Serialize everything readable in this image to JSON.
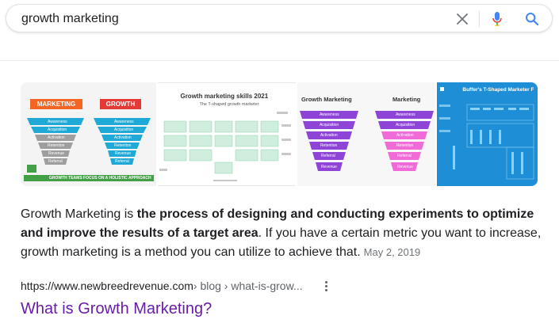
{
  "search": {
    "query": "growth marketing"
  },
  "icons": {
    "clear": "close-icon",
    "mic": "microphone-icon",
    "search": "search-icon"
  },
  "colors": {
    "link_visited": "#681da8",
    "google_blue": "#4285f4",
    "mic_red": "#ea4335"
  },
  "images": [
    {
      "labels": [
        "MARKETING",
        "GROWTH"
      ],
      "left_funnel": [
        "Awareness",
        "Acquisition",
        "Activation",
        "Retention",
        "Revenue",
        "Referral"
      ],
      "right_funnel": [
        "Awareness",
        "Acquisition",
        "Activation",
        "Retention",
        "Revenue",
        "Referral"
      ],
      "footer": "GROWTH TEAMS FOCUS ON A HOLISTIC APPROACH"
    },
    {
      "title": "Growth marketing skills 2021",
      "subtitle": "The T-shaped growth marketer"
    },
    {
      "col_left": "Growth Marketing",
      "col_right": "Marketing",
      "stages": [
        "Awareness",
        "Acquisition",
        "Activation",
        "Retention",
        "Referral",
        "Revenue"
      ]
    },
    {
      "title": "Buffer's T-Shaped Marketer F"
    }
  ],
  "result": {
    "snippet_start": "Growth Marketing is ",
    "snippet_bold": "the process of designing and conducting experiments to optimize and improve the results of a target area",
    "snippet_end": ". If you have a certain metric you want to increase, growth marketing is a method you can utilize to achieve that.",
    "date": "May 2, 2019",
    "url_domain": "https://www.newbreedrevenue.com",
    "url_path": " › blog › what-is-grow...",
    "title": "What is Growth Marketing?"
  }
}
